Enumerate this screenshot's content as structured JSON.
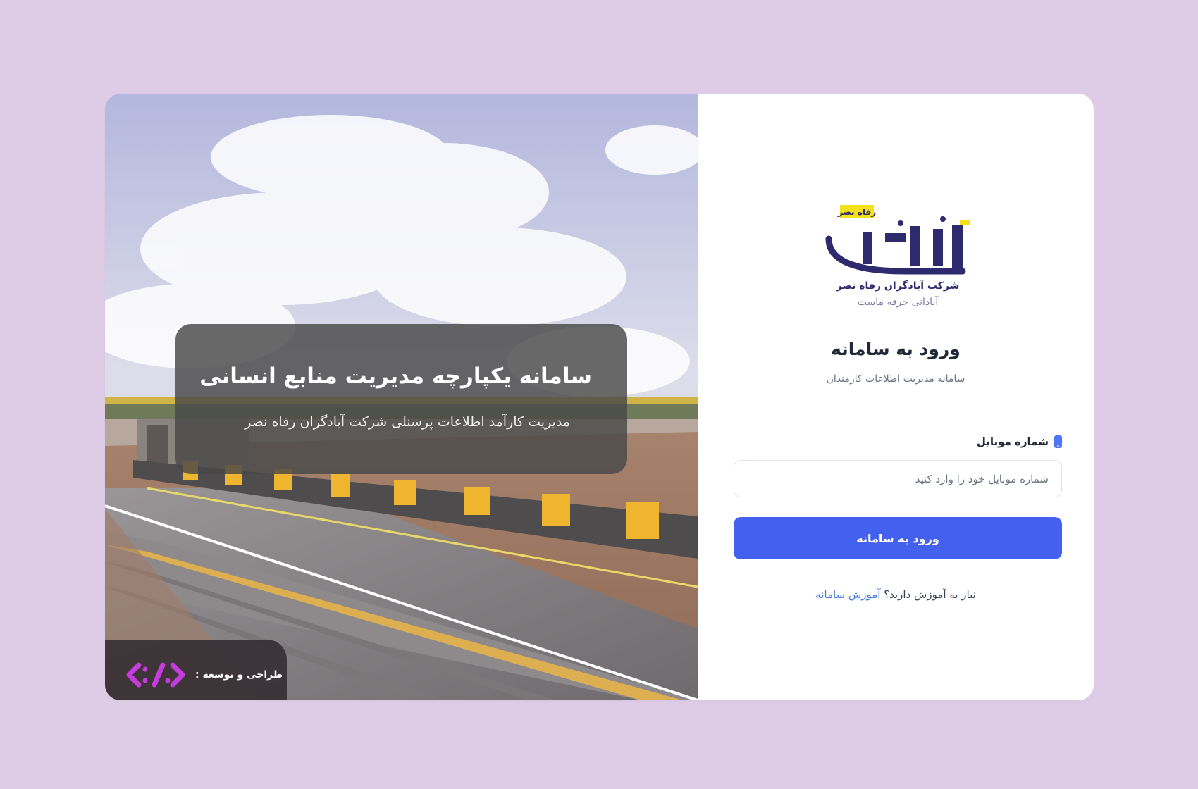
{
  "hero": {
    "heading": "سامانه یکپارچه مدیریت منابع انسانی",
    "subheading": "مدیریت کارآمد اطلاعات پرسنلی شرکت آبادگران رفاه نصر",
    "credit_label": "طراحی و توسعه :"
  },
  "brand": {
    "logo_top": "رفاه نصر",
    "logo_word": "آبادگران",
    "company_name": "شرکت آبادگران رفاه نصر",
    "slogan": "آبادانی حرفه ماست"
  },
  "login": {
    "title": "ورود به سامانه",
    "subtitle": "سامانه مدیریت اطلاعات کارمندان",
    "mobile_label": "شماره موبایل",
    "mobile_placeholder": "شماره موبایل خود را وارد کنید",
    "mobile_value": "",
    "submit_label": "ورود به سامانه",
    "help_text": "نیاز به آموزش دارید؟",
    "help_link": "آموزش سامانه"
  },
  "colors": {
    "background": "#decce6",
    "primary": "#4361ee",
    "link": "#3b74e0",
    "brand_navy": "#2e2a6e",
    "brand_yellow": "#f3e11c",
    "dev_logo": "#c43ddb"
  },
  "icons": {
    "mobile": "mobile-phone-icon",
    "developer": "code-brackets-logo"
  }
}
